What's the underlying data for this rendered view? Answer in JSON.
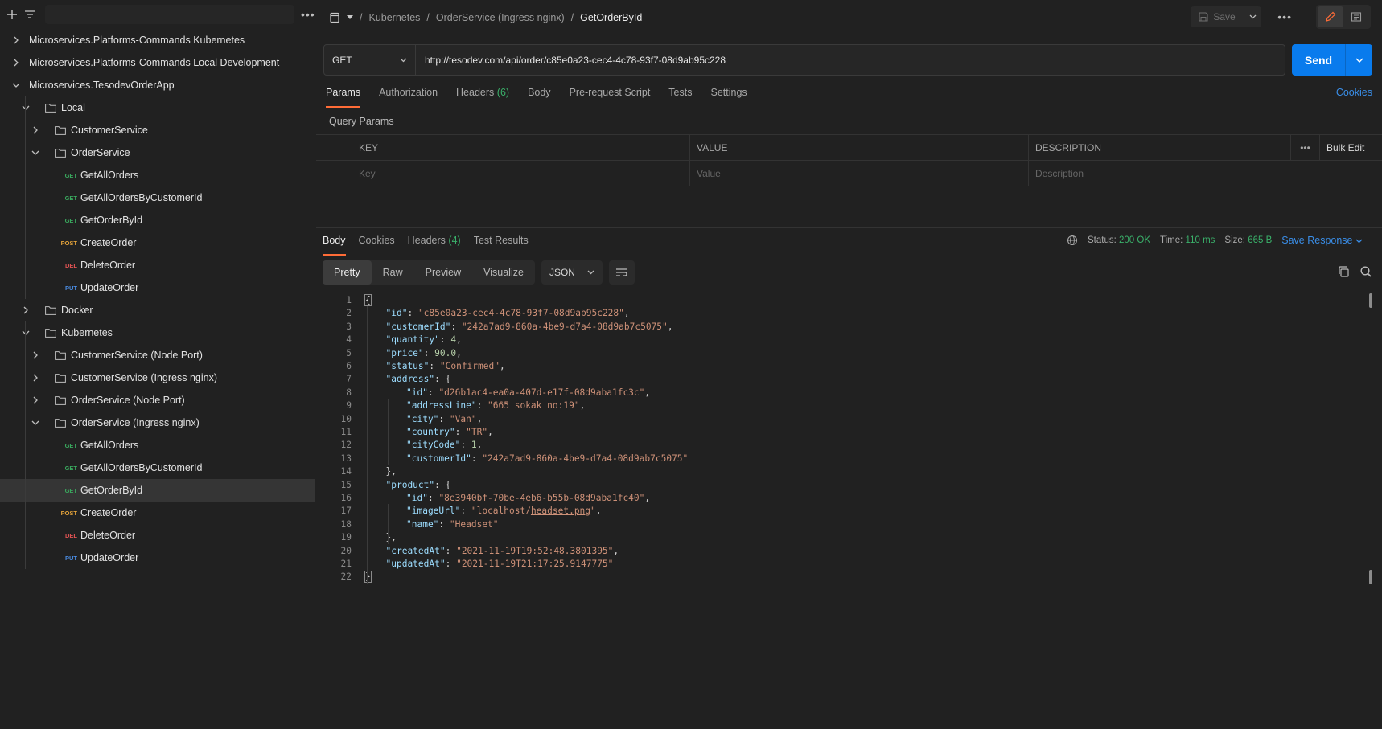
{
  "colors": {
    "accent_orange": "#ff6c37",
    "send_blue": "#097bed",
    "link_blue": "#3a8ee8",
    "success_green": "#3ab06a",
    "get": "#3aa85e",
    "post": "#e2a23a",
    "delete": "#e05252",
    "put": "#4a8be0"
  },
  "sidebar": {
    "tree": [
      {
        "type": "collection",
        "label": "Microservices.Platforms-Commands Kubernetes",
        "expanded": false
      },
      {
        "type": "collection",
        "label": "Microservices.Platforms-Commands Local Development",
        "expanded": false
      },
      {
        "type": "collection",
        "label": "Microservices.TesodevOrderApp",
        "expanded": true
      },
      {
        "type": "folder",
        "label": "Local",
        "expanded": true
      },
      {
        "type": "folder",
        "label": "CustomerService",
        "expanded": false
      },
      {
        "type": "folder",
        "label": "OrderService",
        "expanded": true
      },
      {
        "type": "request",
        "method": "GET",
        "label": "GetAllOrders"
      },
      {
        "type": "request",
        "method": "GET",
        "label": "GetAllOrdersByCustomerId"
      },
      {
        "type": "request",
        "method": "GET",
        "label": "GetOrderById"
      },
      {
        "type": "request",
        "method": "POST",
        "label": "CreateOrder"
      },
      {
        "type": "request",
        "method": "DEL",
        "label": "DeleteOrder"
      },
      {
        "type": "request",
        "method": "PUT",
        "label": "UpdateOrder"
      },
      {
        "type": "folder",
        "label": "Docker",
        "expanded": false
      },
      {
        "type": "folder",
        "label": "Kubernetes",
        "expanded": true
      },
      {
        "type": "folder",
        "label": "CustomerService (Node Port)",
        "expanded": false
      },
      {
        "type": "folder",
        "label": "CustomerService (Ingress nginx)",
        "expanded": false
      },
      {
        "type": "folder",
        "label": "OrderService (Node Port)",
        "expanded": false
      },
      {
        "type": "folder",
        "label": "OrderService (Ingress nginx)",
        "expanded": true
      },
      {
        "type": "request",
        "method": "GET",
        "label": "GetAllOrders"
      },
      {
        "type": "request",
        "method": "GET",
        "label": "GetAllOrdersByCustomerId"
      },
      {
        "type": "request",
        "method": "GET",
        "label": "GetOrderById",
        "selected": true
      },
      {
        "type": "request",
        "method": "POST",
        "label": "CreateOrder"
      },
      {
        "type": "request",
        "method": "DEL",
        "label": "DeleteOrder"
      },
      {
        "type": "request",
        "method": "PUT",
        "label": "UpdateOrder"
      }
    ]
  },
  "header": {
    "breadcrumb": [
      "Kubernetes",
      "OrderService (Ingress nginx)",
      "GetOrderById"
    ],
    "sep": "/",
    "save_label": "Save"
  },
  "request": {
    "method": "GET",
    "url": "http://tesodev.com/api/order/c85e0a23-cec4-4c78-93f7-08d9ab95c228",
    "send_label": "Send",
    "tabs": [
      {
        "label": "Params",
        "active": true
      },
      {
        "label": "Authorization"
      },
      {
        "label": "Headers",
        "count": "(6)"
      },
      {
        "label": "Body"
      },
      {
        "label": "Pre-request Script"
      },
      {
        "label": "Tests"
      },
      {
        "label": "Settings"
      }
    ],
    "cookies_label": "Cookies",
    "query_params": {
      "title": "Query Params",
      "headers": [
        "KEY",
        "VALUE",
        "DESCRIPTION"
      ],
      "bulk_edit": "Bulk Edit",
      "placeholders": [
        "Key",
        "Value",
        "Description"
      ]
    }
  },
  "response": {
    "tabs": [
      {
        "label": "Body",
        "active": true
      },
      {
        "label": "Cookies"
      },
      {
        "label": "Headers",
        "count": "(4)"
      },
      {
        "label": "Test Results"
      }
    ],
    "status_label": "Status:",
    "status_value": "200 OK",
    "time_label": "Time:",
    "time_value": "110 ms",
    "size_label": "Size:",
    "size_value": "665 B",
    "save_response": "Save Response",
    "views": [
      "Pretty",
      "Raw",
      "Preview",
      "Visualize"
    ],
    "active_view": "Pretty",
    "format": "JSON",
    "code_lines": [
      [
        {
          "t": "p",
          "v": "{"
        }
      ],
      [
        {
          "t": "k",
          "v": "\"id\""
        },
        {
          "t": "p",
          "v": ": "
        },
        {
          "t": "s",
          "v": "\"c85e0a23-cec4-4c78-93f7-08d9ab95c228\""
        },
        {
          "t": "p",
          "v": ","
        }
      ],
      [
        {
          "t": "k",
          "v": "\"customerId\""
        },
        {
          "t": "p",
          "v": ": "
        },
        {
          "t": "s",
          "v": "\"242a7ad9-860a-4be9-d7a4-08d9ab7c5075\""
        },
        {
          "t": "p",
          "v": ","
        }
      ],
      [
        {
          "t": "k",
          "v": "\"quantity\""
        },
        {
          "t": "p",
          "v": ": "
        },
        {
          "t": "n",
          "v": "4"
        },
        {
          "t": "p",
          "v": ","
        }
      ],
      [
        {
          "t": "k",
          "v": "\"price\""
        },
        {
          "t": "p",
          "v": ": "
        },
        {
          "t": "n",
          "v": "90.0"
        },
        {
          "t": "p",
          "v": ","
        }
      ],
      [
        {
          "t": "k",
          "v": "\"status\""
        },
        {
          "t": "p",
          "v": ": "
        },
        {
          "t": "s",
          "v": "\"Confirmed\""
        },
        {
          "t": "p",
          "v": ","
        }
      ],
      [
        {
          "t": "k",
          "v": "\"address\""
        },
        {
          "t": "p",
          "v": ": {"
        }
      ],
      [
        {
          "t": "k",
          "v": "\"id\""
        },
        {
          "t": "p",
          "v": ": "
        },
        {
          "t": "s",
          "v": "\"d26b1ac4-ea0a-407d-e17f-08d9aba1fc3c\""
        },
        {
          "t": "p",
          "v": ","
        }
      ],
      [
        {
          "t": "k",
          "v": "\"addressLine\""
        },
        {
          "t": "p",
          "v": ": "
        },
        {
          "t": "s",
          "v": "\"665 sokak no:19\""
        },
        {
          "t": "p",
          "v": ","
        }
      ],
      [
        {
          "t": "k",
          "v": "\"city\""
        },
        {
          "t": "p",
          "v": ": "
        },
        {
          "t": "s",
          "v": "\"Van\""
        },
        {
          "t": "p",
          "v": ","
        }
      ],
      [
        {
          "t": "k",
          "v": "\"country\""
        },
        {
          "t": "p",
          "v": ": "
        },
        {
          "t": "s",
          "v": "\"TR\""
        },
        {
          "t": "p",
          "v": ","
        }
      ],
      [
        {
          "t": "k",
          "v": "\"cityCode\""
        },
        {
          "t": "p",
          "v": ": "
        },
        {
          "t": "n",
          "v": "1"
        },
        {
          "t": "p",
          "v": ","
        }
      ],
      [
        {
          "t": "k",
          "v": "\"customerId\""
        },
        {
          "t": "p",
          "v": ": "
        },
        {
          "t": "s",
          "v": "\"242a7ad9-860a-4be9-d7a4-08d9ab7c5075\""
        }
      ],
      [
        {
          "t": "p",
          "v": "},"
        }
      ],
      [
        {
          "t": "k",
          "v": "\"product\""
        },
        {
          "t": "p",
          "v": ": {"
        }
      ],
      [
        {
          "t": "k",
          "v": "\"id\""
        },
        {
          "t": "p",
          "v": ": "
        },
        {
          "t": "s",
          "v": "\"8e3940bf-70be-4eb6-b55b-08d9aba1fc40\""
        },
        {
          "t": "p",
          "v": ","
        }
      ],
      [
        {
          "t": "k",
          "v": "\"imageUrl\""
        },
        {
          "t": "p",
          "v": ": "
        },
        {
          "t": "s",
          "v": "\"localhost/"
        },
        {
          "t": "su",
          "v": "headset.png"
        },
        {
          "t": "s",
          "v": "\""
        },
        {
          "t": "p",
          "v": ","
        }
      ],
      [
        {
          "t": "k",
          "v": "\"name\""
        },
        {
          "t": "p",
          "v": ": "
        },
        {
          "t": "s",
          "v": "\"Headset\""
        }
      ],
      [
        {
          "t": "p",
          "v": "},"
        }
      ],
      [
        {
          "t": "k",
          "v": "\"createdAt\""
        },
        {
          "t": "p",
          "v": ": "
        },
        {
          "t": "s",
          "v": "\"2021-11-19T19:52:48.3801395\""
        },
        {
          "t": "p",
          "v": ","
        }
      ],
      [
        {
          "t": "k",
          "v": "\"updatedAt\""
        },
        {
          "t": "p",
          "v": ": "
        },
        {
          "t": "s",
          "v": "\"2021-11-19T21:17:25.9147775\""
        }
      ],
      [
        {
          "t": "p",
          "v": "}"
        }
      ]
    ],
    "code_indent": [
      0,
      1,
      1,
      1,
      1,
      1,
      1,
      2,
      2,
      2,
      2,
      2,
      2,
      1,
      1,
      2,
      2,
      2,
      1,
      1,
      1,
      0
    ]
  }
}
